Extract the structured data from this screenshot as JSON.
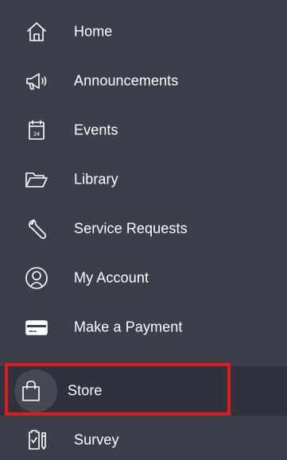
{
  "menu": {
    "items": [
      {
        "label": "Home",
        "icon": "home-icon"
      },
      {
        "label": "Announcements",
        "icon": "megaphone-icon"
      },
      {
        "label": "Events",
        "icon": "calendar-icon",
        "calendar_day": "24"
      },
      {
        "label": "Library",
        "icon": "folder-icon"
      },
      {
        "label": "Service Requests",
        "icon": "wrench-icon"
      },
      {
        "label": "My Account",
        "icon": "user-circle-icon"
      },
      {
        "label": "Make a Payment",
        "icon": "credit-card-icon"
      },
      {
        "label": "Store",
        "icon": "shopping-bag-icon",
        "active": true
      },
      {
        "label": "Survey",
        "icon": "clipboard-check-icon"
      }
    ]
  },
  "colors": {
    "background": "#3b3f4a",
    "active_background": "#2e323c",
    "text": "#ffffff",
    "highlight": "#e0191f"
  }
}
